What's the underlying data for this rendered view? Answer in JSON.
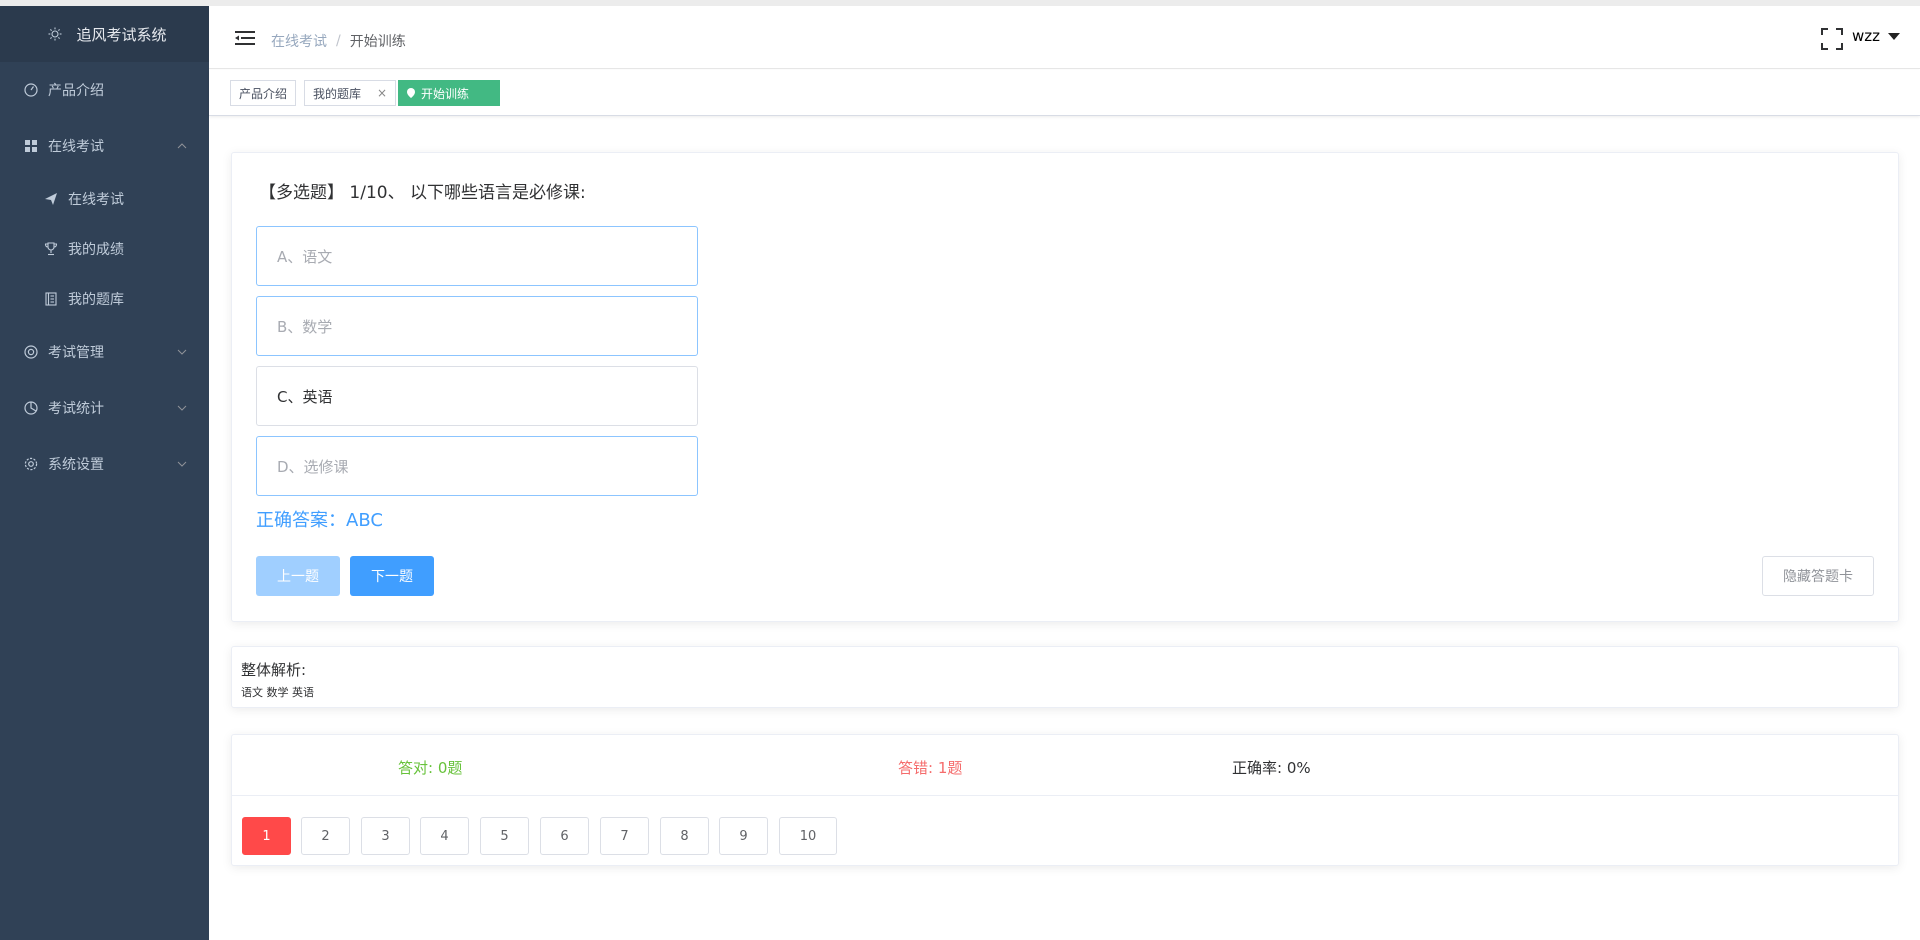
{
  "app": {
    "title": "追风考试系统"
  },
  "sidebar": {
    "items": [
      {
        "label": "产品介绍",
        "icon": "dashboard-icon"
      },
      {
        "label": "在线考试",
        "icon": "grid-icon",
        "expanded": true
      },
      {
        "label": "考试管理",
        "icon": "lifebuoy-icon"
      },
      {
        "label": "考试统计",
        "icon": "pie-chart-icon"
      },
      {
        "label": "系统设置",
        "icon": "gear-icon"
      }
    ],
    "subitems": [
      {
        "label": "在线考试",
        "icon": "paper-plane-icon"
      },
      {
        "label": "我的成绩",
        "icon": "trophy-icon"
      },
      {
        "label": "我的题库",
        "icon": "notebook-icon"
      }
    ]
  },
  "header": {
    "breadcrumb": [
      "在线考试",
      "开始训练"
    ],
    "separator": "/",
    "user": "wzz"
  },
  "tags": [
    {
      "label": "产品介绍"
    },
    {
      "label": "我的题库",
      "close": "×"
    },
    {
      "label": "开始训练",
      "active": true
    }
  ],
  "question": {
    "text": "【多选题】 1/10、 以下哪些语言是必修课:",
    "options": [
      "A、语文",
      "B、数学",
      "C、英语",
      "D、选修课"
    ],
    "answer": "正确答案：ABC"
  },
  "buttons": {
    "prev": "上一题",
    "next": "下一题",
    "hide_card": "隐藏答题卡"
  },
  "analysis": {
    "title": "整体解析:",
    "text": "语文 数学 英语"
  },
  "stats": {
    "right": "答对: 0题",
    "wrong": "答错: 1题",
    "rate": "正确率: 0%"
  },
  "question_numbers": [
    "1",
    "2",
    "3",
    "4",
    "5",
    "6",
    "7",
    "8",
    "9",
    "10"
  ],
  "colors": {
    "sidebar_bg": "#304156",
    "accent": "#409eff",
    "tag_active": "#42b983",
    "wrong": "#f56c6c",
    "right": "#67c23a",
    "current_q": "#ff4949"
  }
}
